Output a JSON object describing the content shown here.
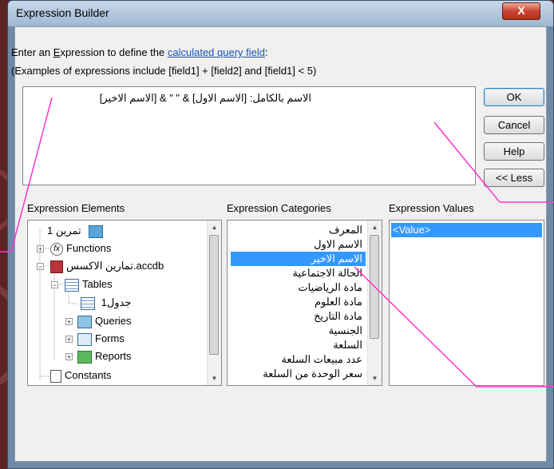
{
  "window": {
    "title": "Expression Builder",
    "close_label": "X"
  },
  "intro": {
    "line1_prefix": "Enter an ",
    "line1_hot": "E",
    "line1_mid": "xpression to define the ",
    "line1_link": "calculated query field",
    "line1_suffix": ":",
    "line2": "(Examples of expressions include [field1] + [field2] and [field1] < 5)"
  },
  "expression": {
    "text": "الاسم بالكامل: [الاسم الاول] & \" \" & [الاسم الاخير]"
  },
  "buttons": {
    "ok": "OK",
    "cancel": "Cancel",
    "help": "Help",
    "less": "<< Less"
  },
  "elements": {
    "label": "Expression Elements",
    "items": [
      "تمرين 1",
      "Functions",
      "تمارين الاكسس.accdb",
      "Tables",
      "جدول1",
      "Queries",
      "Forms",
      "Reports",
      "Constants"
    ]
  },
  "categories": {
    "label": "Expression Categories",
    "items": [
      "المعرف",
      "الاسم الاول",
      "الاسم الاخير",
      "الحالة الاجتماعية",
      "مادة الرياضيات",
      "مادة العلوم",
      "مادة التاريخ",
      "الجنسية",
      "السلعة",
      "عدد مبيعات السلعة",
      "سعر الوحدة من السلعة"
    ],
    "selected": "الاسم الاخير"
  },
  "values": {
    "label": "Expression Values",
    "items": [
      "<Value>"
    ]
  },
  "colors": {
    "selection": "#3399ff",
    "annotation": "#ff33cc",
    "link": "#1a53b7"
  }
}
